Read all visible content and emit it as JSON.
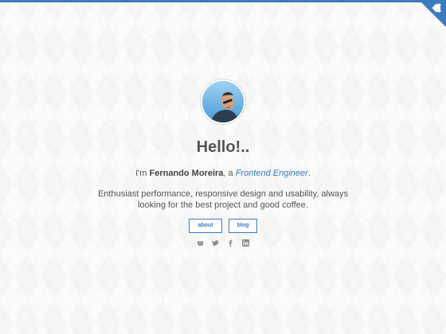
{
  "intro": {
    "prefix": "I'm ",
    "name": "Fernando Moreira",
    "middle": ", a ",
    "role": "Frontend Engineer",
    "suffix": "."
  },
  "greeting": "Hello!..",
  "bio": "Enthusiast performance, responsive design and usability, always looking for the best project and good coffee.",
  "buttons": {
    "about": "about",
    "blog": "blog"
  },
  "social": [
    "github-icon",
    "twitter-icon",
    "facebook-icon",
    "linkedin-icon"
  ],
  "colors": {
    "accent": "#3c7bbd",
    "text": "#555555",
    "background": "#fbfbfb"
  }
}
